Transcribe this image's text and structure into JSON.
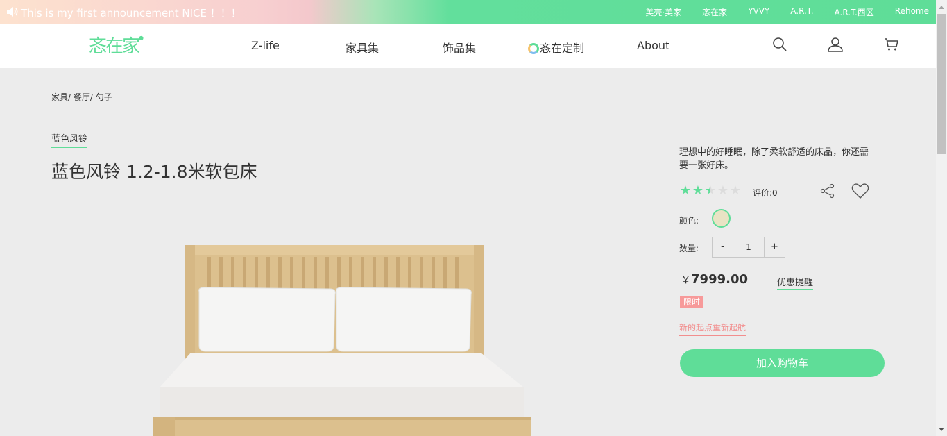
{
  "announcement": {
    "text": "This is my first announcement NICE ！！！",
    "links": [
      "美壳·美家",
      "忞在家",
      "YVVY",
      "A.R.T.",
      "A.R.T.西区",
      "Rehome"
    ]
  },
  "header": {
    "logo_text": "忞在家",
    "nav": [
      "Z-life",
      "家具集",
      "饰品集",
      "忞在定制",
      "About"
    ],
    "icons": [
      "search-icon",
      "user-icon",
      "cart-icon"
    ]
  },
  "breadcrumb": "家具/ 餐厅/ 勺子",
  "product": {
    "series": "蓝色风铃",
    "title": "蓝色风铃 1.2-1.8米软包床",
    "description": "理想中的好睡眠，除了柔软舒适的床品，你还需要一张好床。",
    "rating_stars": 2.5,
    "rating_max": 5,
    "review_label": "评价:0",
    "color_label": "颜色:",
    "color_value": "#e9e3c4",
    "quantity_label": "数量:",
    "quantity": "1",
    "minus": "-",
    "plus": "+",
    "currency": "￥",
    "price": "7999.00",
    "discount_remind": "优惠提醒",
    "badge": "限时",
    "promo_text": "新的起点重新起航",
    "add_to_cart": "加入购物车"
  },
  "colors": {
    "accent": "#5fdd98",
    "promo": "#f28e8e",
    "badge_bg": "#f79a9a",
    "page_bg": "#ececec"
  }
}
